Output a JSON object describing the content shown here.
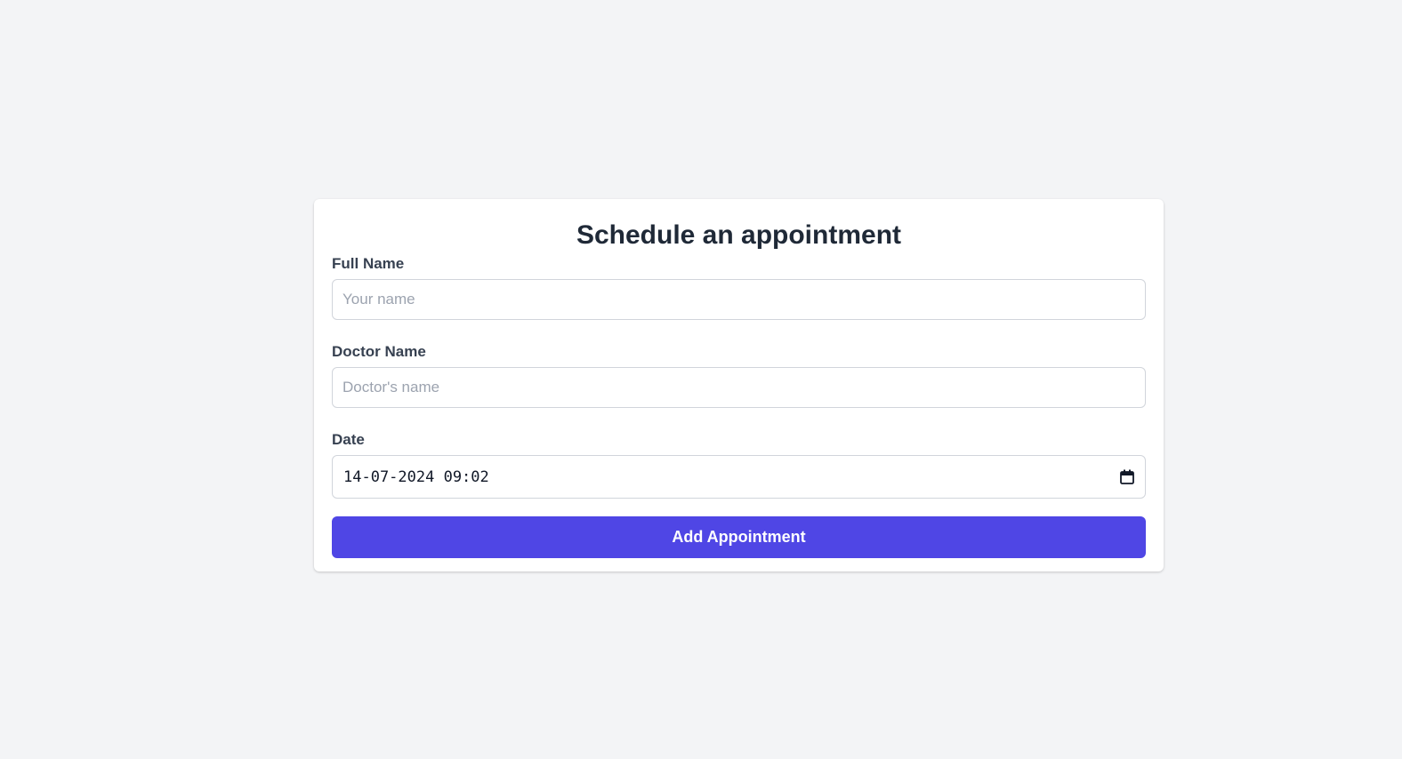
{
  "form": {
    "title": "Schedule an appointment",
    "full_name": {
      "label": "Full Name",
      "placeholder": "Your name",
      "value": ""
    },
    "doctor_name": {
      "label": "Doctor Name",
      "placeholder": "Doctor's name",
      "value": ""
    },
    "date": {
      "label": "Date",
      "value": "14-07-2024 09:02",
      "icon": "calendar-icon"
    },
    "submit_label": "Add Appointment"
  },
  "colors": {
    "background": "#f3f4f6",
    "card": "#ffffff",
    "accent": "#4f46e5",
    "title_text": "#1f2937",
    "label_text": "#374151",
    "placeholder_text": "#9ca3af",
    "input_border": "#d1d5db"
  }
}
